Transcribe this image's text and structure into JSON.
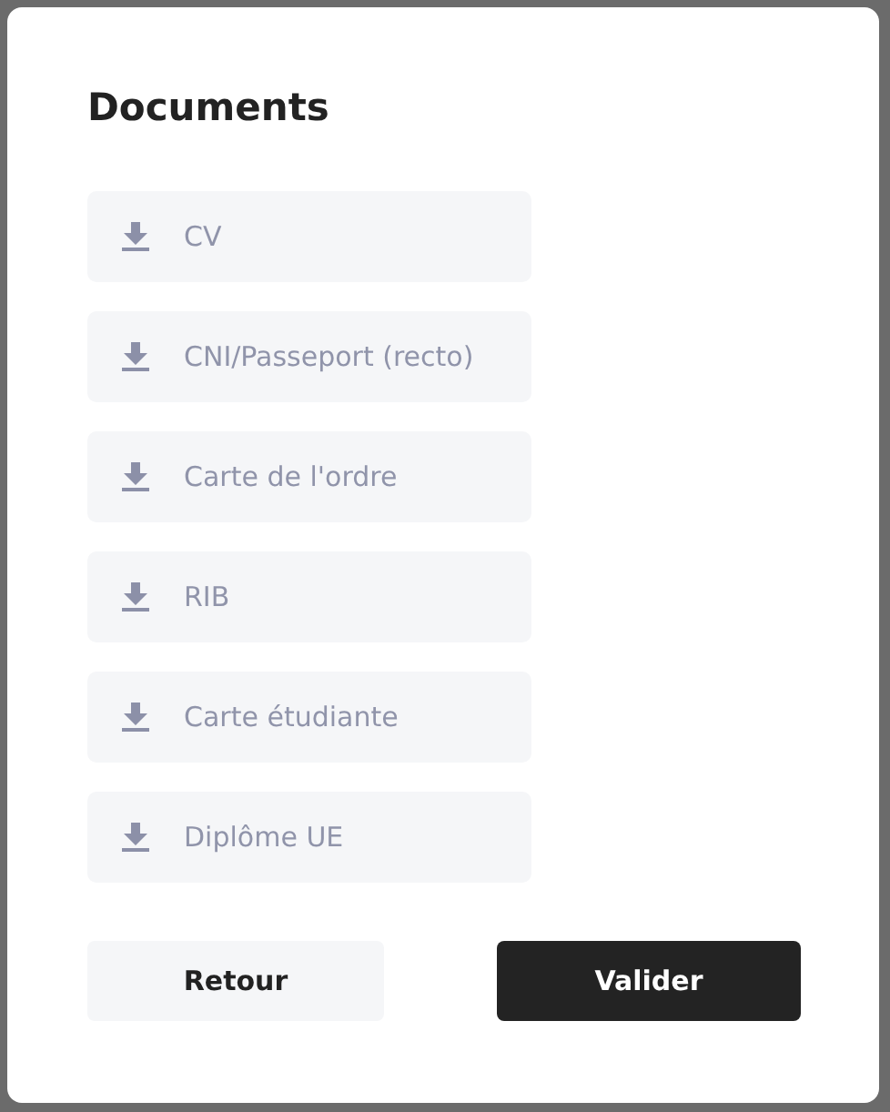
{
  "dialog": {
    "title": "Documents",
    "documents": [
      {
        "label": "CV"
      },
      {
        "label": "CNI/Passeport (recto)"
      },
      {
        "label": "Carte de l'ordre"
      },
      {
        "label": "RIB"
      },
      {
        "label": "Carte étudiante"
      },
      {
        "label": "Diplôme UE"
      }
    ],
    "buttons": [
      {
        "label": "Retour",
        "kind": "secondary"
      },
      {
        "label": "Valider",
        "kind": "primary"
      }
    ]
  }
}
